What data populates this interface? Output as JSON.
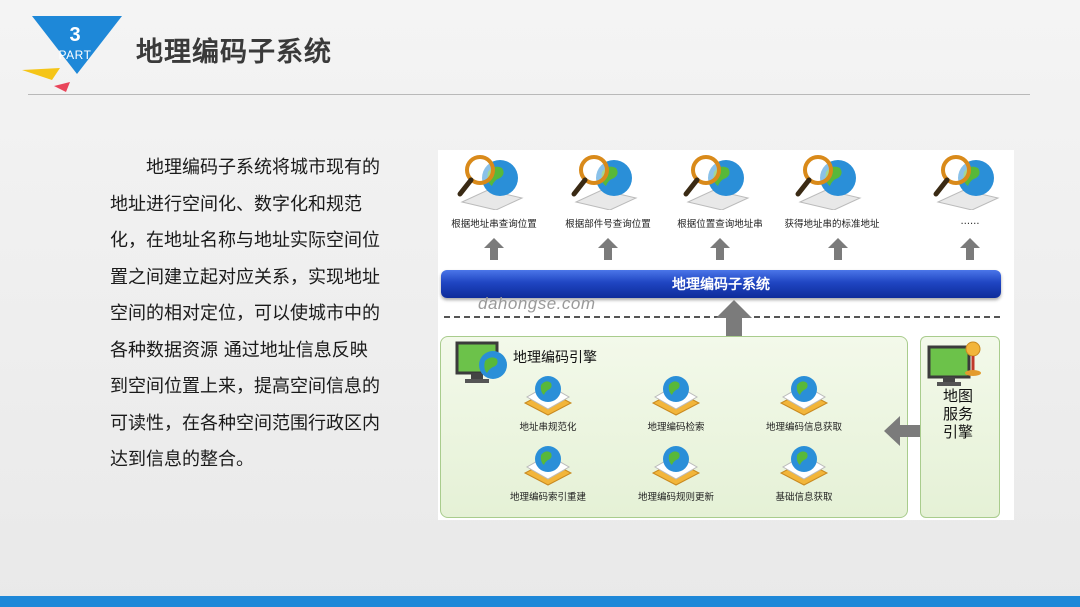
{
  "header": {
    "badge_number": "3",
    "badge_text": "PART",
    "title": "地理编码子系统"
  },
  "body_text": "地理编码子系统将城市现有的地址进行空间化、数字化和规范化，在地址名称与地址实际空间位置之间建立起对应关系，实现地址空间的相对定位，可以使城市中的各种数据资源 通过地址信息反映到空间位置上来，提高空间信息的可读性，在各种空间范围行政区内达到信息的整合。",
  "diagram": {
    "top_items": [
      {
        "label": "根据地址串查询位置"
      },
      {
        "label": "根据部件号查询位置"
      },
      {
        "label": "根据位置查询地址串"
      },
      {
        "label": "获得地址串的标准地址"
      },
      {
        "label": "……"
      }
    ],
    "main_bar_label": "地理编码子系统",
    "watermark": "dahongse.com",
    "engine": {
      "title": "地理编码引擎",
      "items": [
        {
          "label": "地址串规范化"
        },
        {
          "label": "地理编码检索"
        },
        {
          "label": "地理编码信息获取"
        },
        {
          "label": "地理编码索引重建"
        },
        {
          "label": "地理编码规则更新"
        },
        {
          "label": "基础信息获取"
        }
      ]
    },
    "map_service_label": "地图服务引擎"
  },
  "colors": {
    "accent_blue": "#1e88d8",
    "bar_blue": "#1f45c2",
    "panel_green": "#e5f1d6",
    "badge_yellow": "#f5c518",
    "badge_red": "#e9455a"
  }
}
